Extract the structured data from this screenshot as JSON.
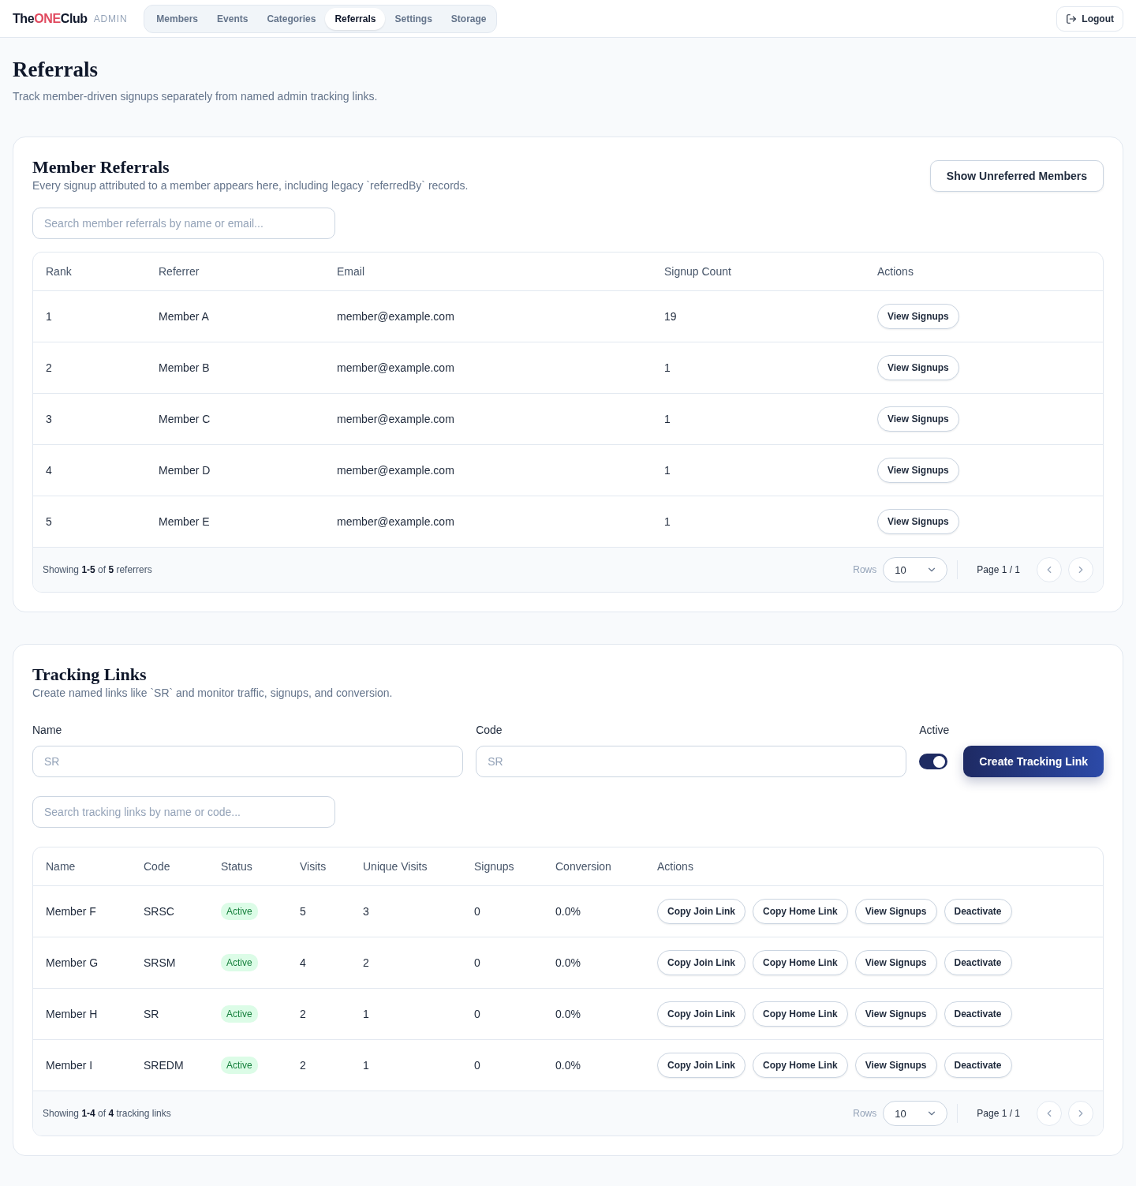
{
  "header": {
    "logo": {
      "before": "The",
      "accent": "ONE",
      "after": "Club"
    },
    "badge": "ADMIN",
    "nav": [
      {
        "label": "Members",
        "selected": false
      },
      {
        "label": "Events",
        "selected": false
      },
      {
        "label": "Categories",
        "selected": false
      },
      {
        "label": "Referrals",
        "selected": true
      },
      {
        "label": "Settings",
        "selected": false
      },
      {
        "label": "Storage",
        "selected": false
      }
    ],
    "logout": "Logout"
  },
  "page": {
    "title": "Referrals",
    "subtitle": "Track member-driven signups separately from named admin tracking links."
  },
  "member_referrals": {
    "title": "Member Referrals",
    "subtitle": "Every signup attributed to a member appears here, including legacy `referredBy` records.",
    "toggle_button": "Show Unreferred Members",
    "search": {
      "placeholder": "Search member referrals by name or email..."
    },
    "table": {
      "columns": [
        "Rank",
        "Referrer",
        "Email",
        "Signup Count",
        "Actions"
      ],
      "rows": [
        {
          "rank": "1",
          "referrer": "Member A",
          "email": "member@example.com",
          "signup_count": "19",
          "action": "View Signups"
        },
        {
          "rank": "2",
          "referrer": "Member B",
          "email": "member@example.com",
          "signup_count": "1",
          "action": "View Signups"
        },
        {
          "rank": "3",
          "referrer": "Member C",
          "email": "member@example.com",
          "signup_count": "1",
          "action": "View Signups"
        },
        {
          "rank": "4",
          "referrer": "Member D",
          "email": "member@example.com",
          "signup_count": "1",
          "action": "View Signups"
        },
        {
          "rank": "5",
          "referrer": "Member E",
          "email": "member@example.com",
          "signup_count": "1",
          "action": "View Signups"
        }
      ]
    },
    "footer": {
      "summary": "Showing **1-5** of **5** referrers",
      "rows_label": "Rows",
      "rows_value": "10",
      "page": "Page 1 / 1"
    }
  },
  "tracking_links": {
    "title": "Tracking Links",
    "subtitle": "Create named links like `SR` and monitor traffic, signups, and conversion.",
    "form": {
      "fields": [
        {
          "label": "Name",
          "placeholder": "SR"
        },
        {
          "label": "Code",
          "placeholder": "SR"
        }
      ],
      "active": {
        "label": "Active",
        "on": true
      },
      "submit": "Create Tracking Link"
    },
    "search": {
      "placeholder": "Search tracking links by name or code..."
    },
    "table": {
      "columns": [
        "Name",
        "Code",
        "Status",
        "Visits",
        "Unique Visits",
        "Signups",
        "Conversion",
        "Actions"
      ],
      "rows": [
        {
          "name": "Member F",
          "code": "SRSC",
          "status": "Active",
          "active": true,
          "visits": "5",
          "unique_visits": "3",
          "signups": "0",
          "conversion": "0.0%",
          "actions": [
            "Copy Join Link",
            "Copy Home Link",
            "View Signups",
            "Deactivate"
          ]
        },
        {
          "name": "Member G",
          "code": "SRSM",
          "status": "Active",
          "active": true,
          "visits": "4",
          "unique_visits": "2",
          "signups": "0",
          "conversion": "0.0%",
          "actions": [
            "Copy Join Link",
            "Copy Home Link",
            "View Signups",
            "Deactivate"
          ]
        },
        {
          "name": "Member H",
          "code": "SR",
          "status": "Active",
          "active": true,
          "visits": "2",
          "unique_visits": "1",
          "signups": "0",
          "conversion": "0.0%",
          "actions": [
            "Copy Join Link",
            "Copy Home Link",
            "View Signups",
            "Deactivate"
          ]
        },
        {
          "name": "Member I",
          "code": "SREDM",
          "status": "Active",
          "active": true,
          "visits": "2",
          "unique_visits": "1",
          "signups": "0",
          "conversion": "0.0%",
          "actions": [
            "Copy Join Link",
            "Copy Home Link",
            "View Signups",
            "Deactivate"
          ]
        }
      ]
    },
    "footer": {
      "summary": "Showing **1-4** of **4** tracking links",
      "rows_label": "Rows",
      "rows_value": "10",
      "page": "Page 1 / 1"
    }
  }
}
